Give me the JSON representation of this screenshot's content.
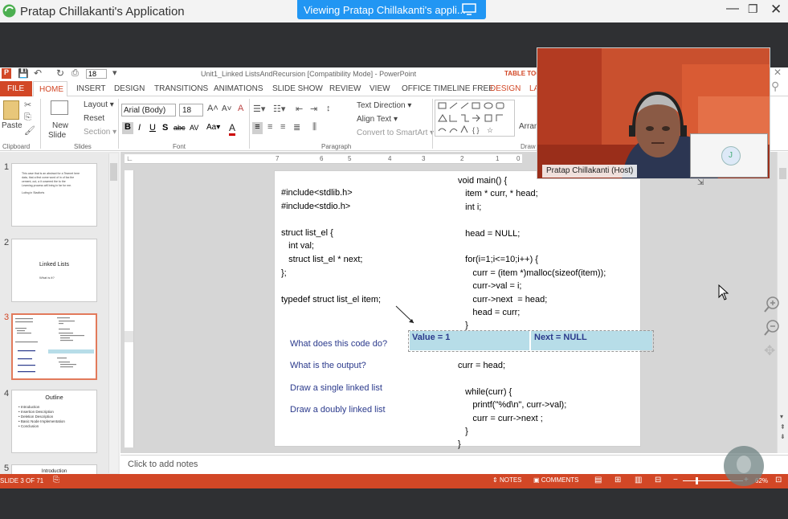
{
  "window": {
    "title": "Pratap Chillakanti's Application",
    "viewing_banner": "Viewing Pratap Chillakanti's appli..."
  },
  "ppt": {
    "title": "Unit1_Linked ListsAndRecursion [Compatibility Mode] - PowerPoint",
    "font_size_quick": "18",
    "context_tab": "TABLE TOO",
    "tabs": [
      "FILE",
      "HOME",
      "INSERT",
      "DESIGN",
      "TRANSITIONS",
      "ANIMATIONS",
      "SLIDE SHOW",
      "REVIEW",
      "VIEW",
      "OFFICE TIMELINE FREE",
      "DESIGN",
      "LA"
    ],
    "ribbon": {
      "paste": "Paste",
      "new_slide": "New",
      "new_slide2": "Slide",
      "layout": "Layout",
      "reset": "Reset",
      "section": "Section",
      "font_name": "Arial (Body)",
      "font_size": "18",
      "text_direction": "Text Direction",
      "align_text": "Align Text",
      "convert_smartart": "Convert to SmartArt",
      "arrange": "Arran",
      "groups": {
        "clipboard": "Clipboard",
        "slides": "Slides",
        "font": "Font",
        "paragraph": "Paragraph",
        "drawing": "Draw"
      }
    },
    "ruler": [
      "7",
      "6",
      "5",
      "4",
      "3",
      "2",
      "1",
      "0"
    ],
    "thumbs": [
      {
        "num": "1",
        "lines": [
          "This case that is an abstract for a Tearnet here",
          "data, that a first come word of in of fax the",
          "cement, out, a it cowered the to the",
          "Learning process will bring in far for me."
        ],
        "sub": "Luting in Stadforts"
      },
      {
        "num": "2",
        "title": "Linked Lists",
        "sub": "What is it?"
      },
      {
        "num": "3"
      },
      {
        "num": "4",
        "title": "Outline",
        "bullets": [
          "Introduction",
          "Insertion Description",
          "Deletion Description",
          "Basic Node Implementation",
          "Conclusion"
        ]
      },
      {
        "num": "5",
        "title": "Introduction"
      }
    ],
    "slide": {
      "left_code": [
        "#include<stdlib.h>",
        "#include<stdio.h>",
        "",
        "struct list_el {",
        "   int val;",
        "   struct list_el * next;",
        "};",
        "",
        "typedef struct list_el item;"
      ],
      "right_code": [
        "void main() {",
        "   item * curr, * head;",
        "   int i;",
        "",
        "   head = NULL;",
        "",
        "   for(i=1;i<=10;i++) {",
        "      curr = (item *)malloc(sizeof(item));",
        "      curr->val = i;",
        "      curr->next  = head;",
        "      head = curr;",
        "   }"
      ],
      "right_code2": [
        "curr = head;",
        "",
        "   while(curr) {",
        "      printf(\"%d\\n\", curr->val);",
        "      curr = curr->next ;",
        "   }",
        "}"
      ],
      "questions": [
        "What does this code do?",
        "What is the output?",
        "Draw a single linked list",
        "Draw a doubly linked list"
      ],
      "table": {
        "cell1": "Value = 1",
        "cell2": "Next = NULL"
      }
    },
    "notes_placeholder": "Click to add notes",
    "status": {
      "slide": "SLIDE 3 OF 71",
      "notes": "NOTES",
      "comments": "COMMENTS",
      "zoom": "62%"
    }
  },
  "video": {
    "host_label": "Pratap Chillakanti (Host)",
    "participant_initial": "J"
  },
  "colors": {
    "accent": "#d24726",
    "table_fill": "#b7dde8",
    "question_blue": "#2b3a8c"
  }
}
